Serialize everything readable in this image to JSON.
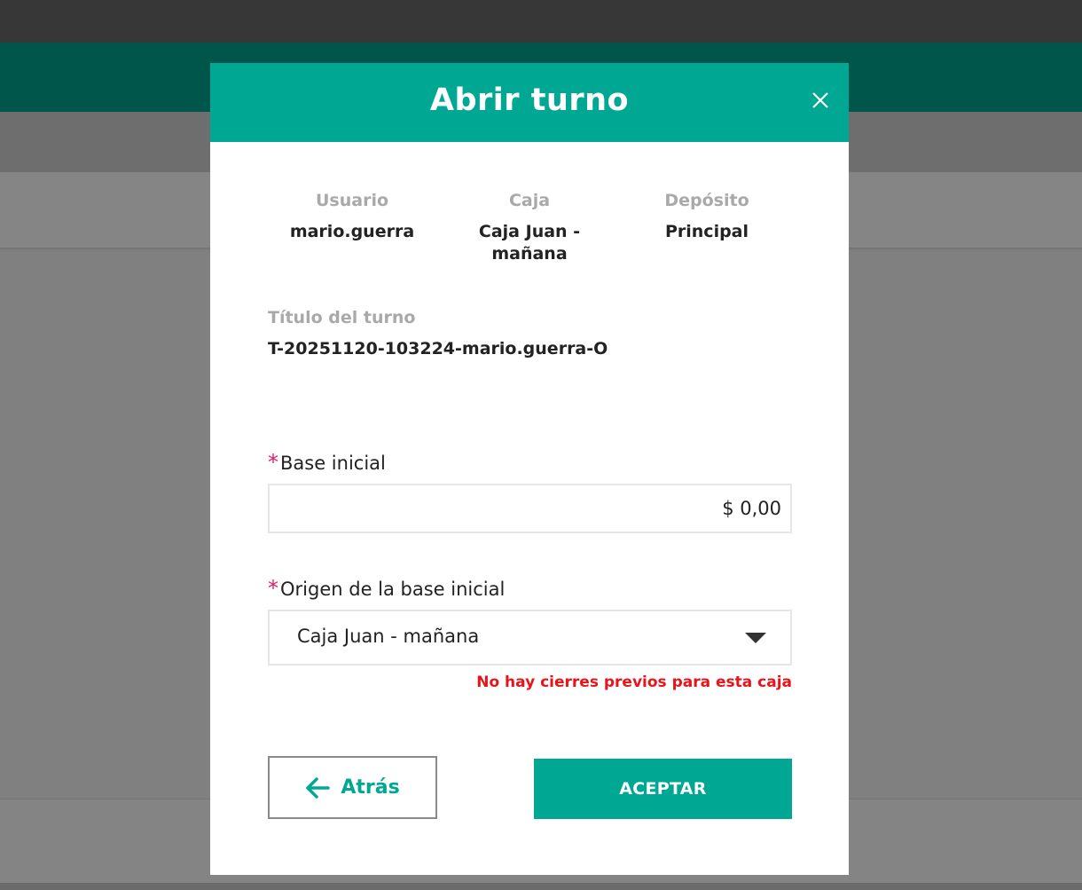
{
  "modal": {
    "title": "Abrir turno",
    "close_icon": "close-icon"
  },
  "info": {
    "user_label": "Usuario",
    "user_value": "mario.guerra",
    "cash_label": "Caja",
    "cash_value": "Caja Juan - mañana",
    "depot_label": "Depósito",
    "depot_value": "Principal"
  },
  "shift_title": {
    "label": "Título del turno",
    "value": "T-20251120-103224-mario.guerra-O"
  },
  "base": {
    "required_mark": "*",
    "label": "Base inicial",
    "value": "$ 0,00"
  },
  "origin": {
    "required_mark": "*",
    "label": "Origen de la base inicial",
    "selected": "Caja Juan - mañana",
    "error": "No hay cierres previos para esta caja"
  },
  "actions": {
    "back_label": "Atrás",
    "back_icon": "arrow-left-icon",
    "accept_label": "ACEPTAR"
  },
  "colors": {
    "accent": "#00a893",
    "error": "#e8141b",
    "required": "#e6196b"
  }
}
